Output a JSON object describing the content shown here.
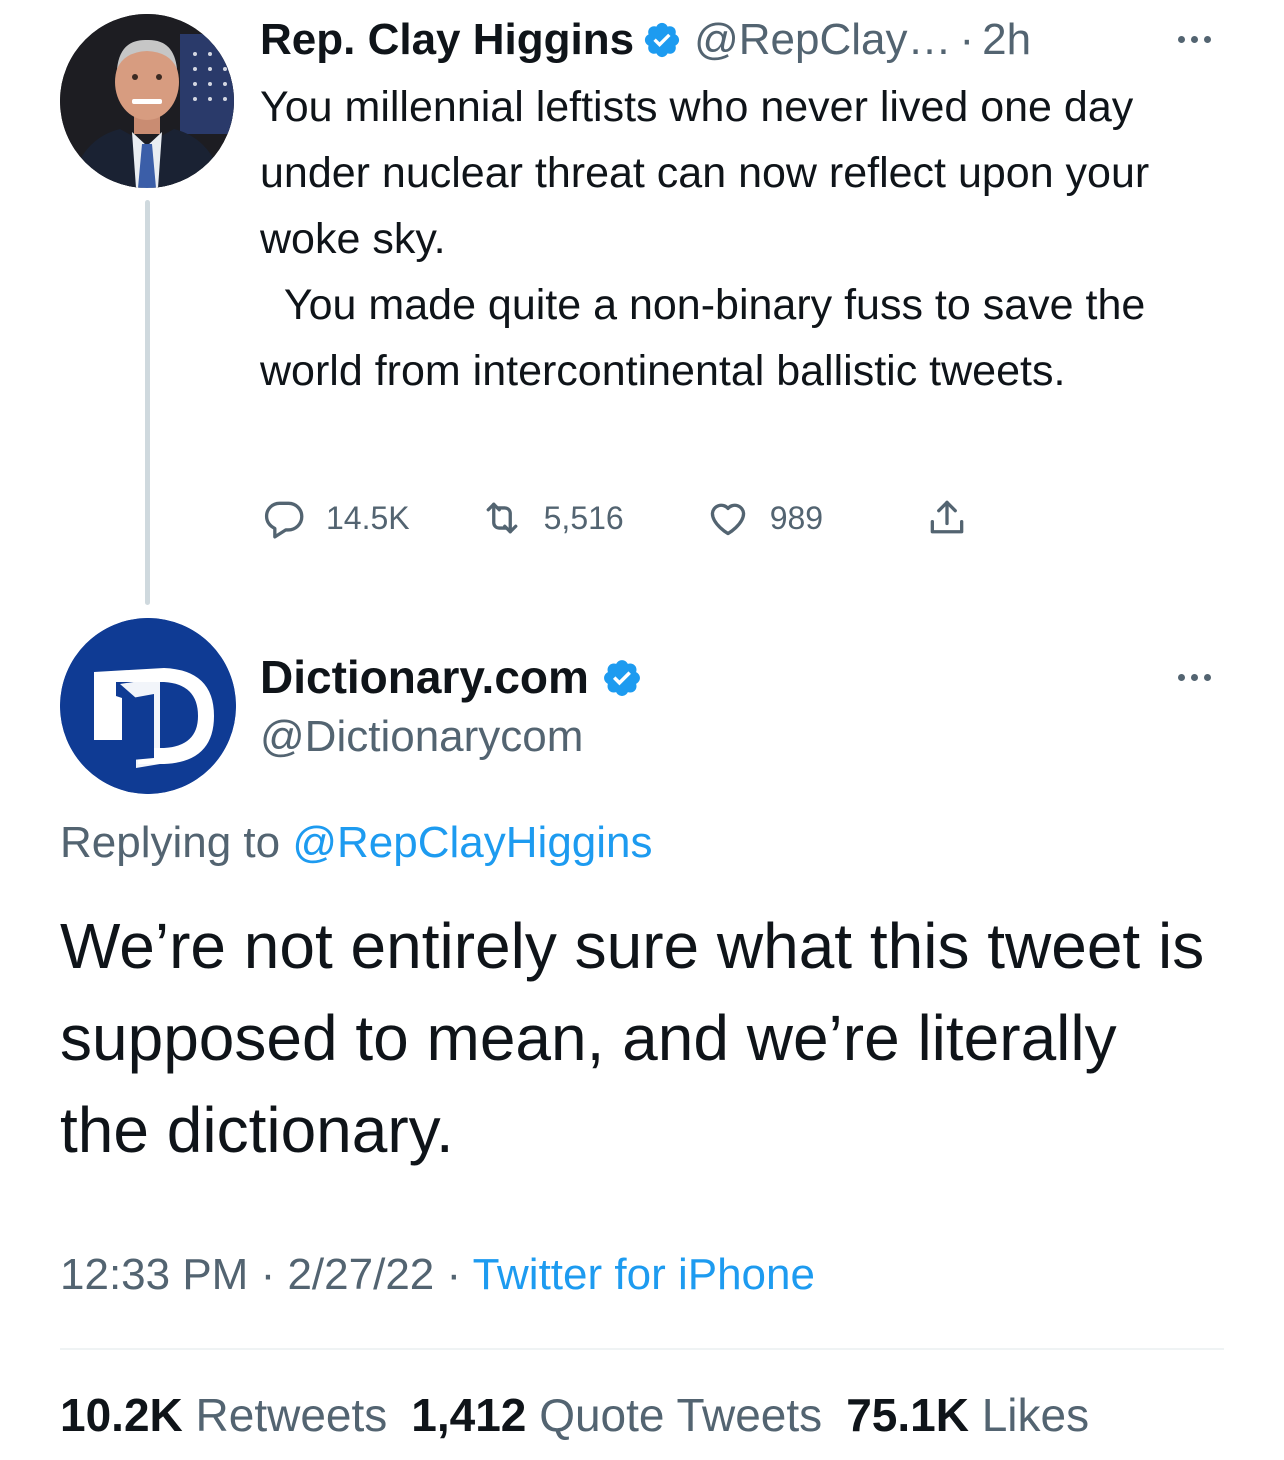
{
  "parent": {
    "name": "Rep. Clay Higgins",
    "handle": "@RepClay…",
    "separator": "·",
    "time": "2h",
    "text": "You millennial leftists who never lived one day under nuclear threat can now reflect upon your woke sky.\n  You made quite a non-binary fuss to save the world from intercontinental ballistic tweets.",
    "replies": "14.5K",
    "retweets": "5,516",
    "likes": "989",
    "avatar_icon": "person-portrait-icon"
  },
  "reply": {
    "name": "Dictionary.com",
    "handle": "@Dictionarycom",
    "replying_prefix": "Replying to ",
    "replying_to": "@RepClayHiggins",
    "text": "We’re not entirely sure what this tweet is supposed to mean, and we’re literally the dictionary.",
    "time": "12:33 PM",
    "date": "2/27/22",
    "source": "Twitter for iPhone",
    "meta_sep": " · ",
    "stats": {
      "retweets_count": "10.2K",
      "retweets_label": "Retweets",
      "quotes_count": "1,412",
      "quotes_label": "Quote Tweets",
      "likes_count": "75.1K",
      "likes_label": "Likes"
    },
    "avatar_icon": "dictionary-logo-icon"
  },
  "colors": {
    "text": "#0f1419",
    "secondary": "#536471",
    "link": "#1d9bf0",
    "verified": "#1d9bf0",
    "thread_line": "#cfd9de",
    "dictionary_blue": "#0f3b94"
  }
}
